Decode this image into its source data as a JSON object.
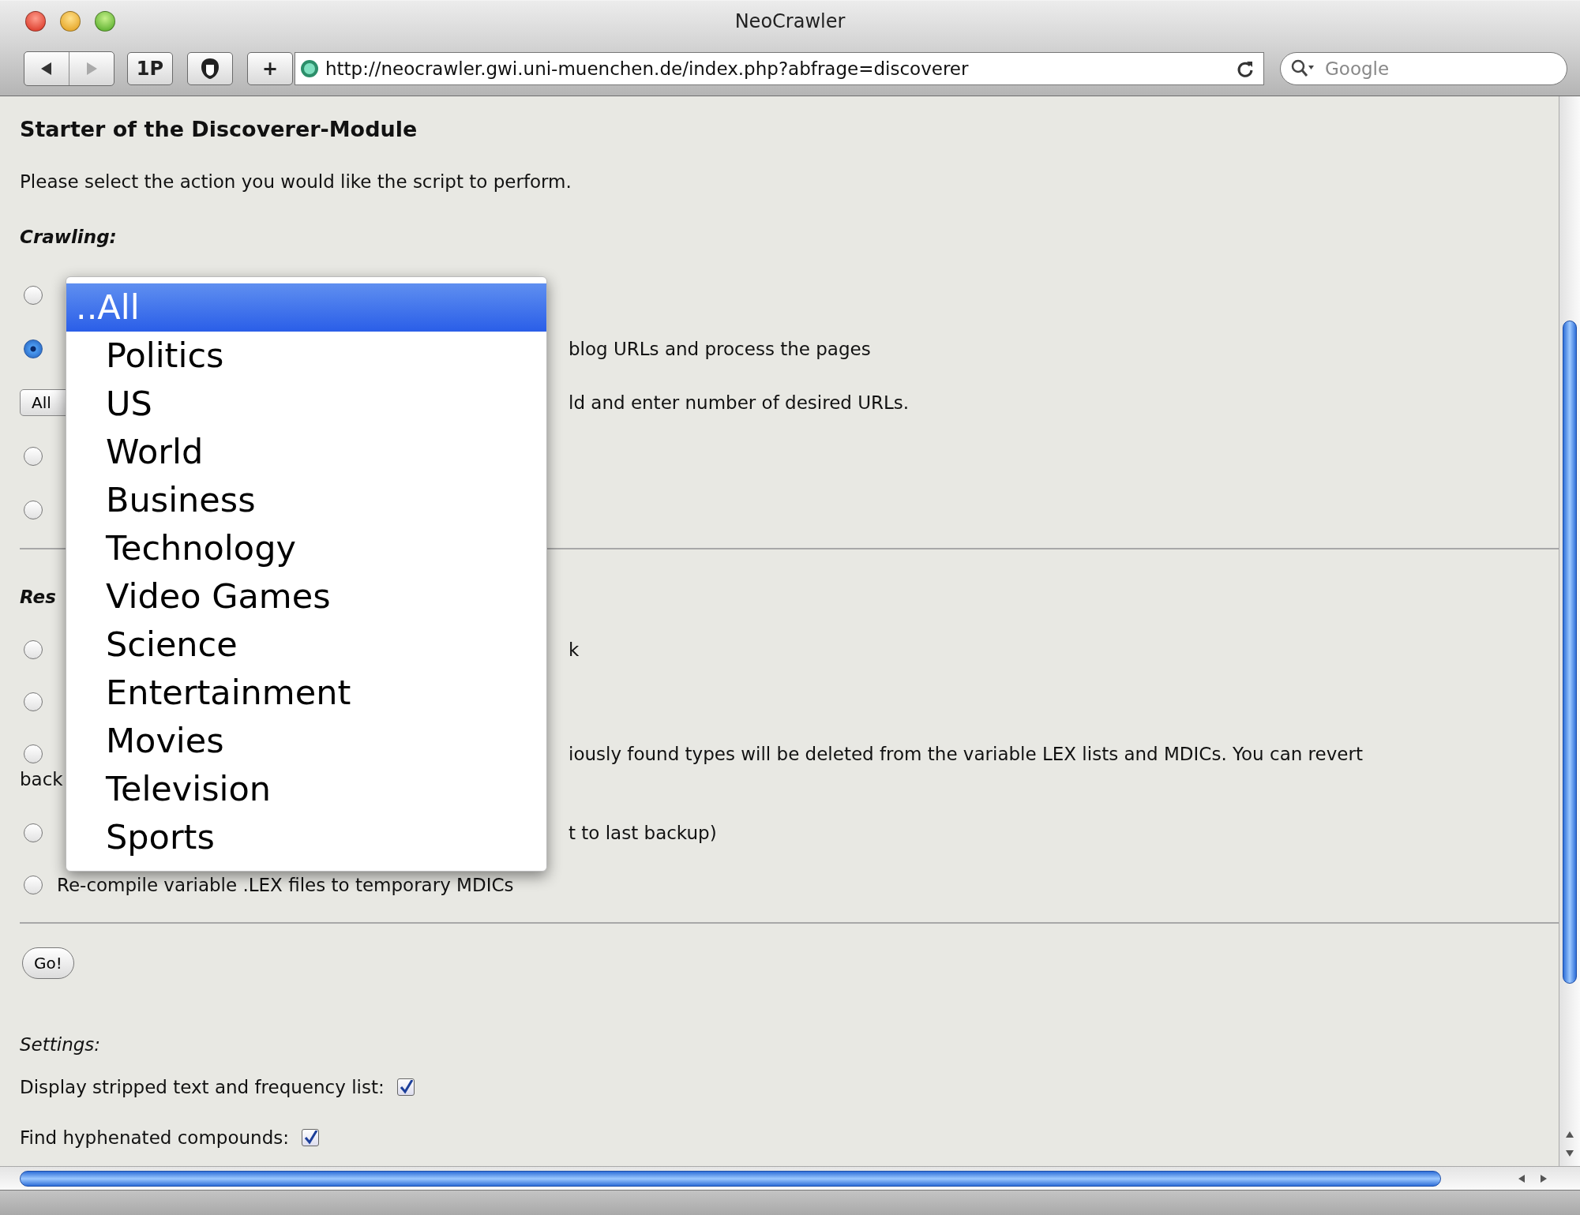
{
  "window": {
    "title": "NeoCrawler"
  },
  "toolbar": {
    "bookmarks_button": "1P",
    "add_button": "+",
    "url": "http://neocrawler.gwi.uni-muenchen.de/index.php?abfrage=discoverer",
    "search": {
      "placeholder": "Google"
    }
  },
  "page": {
    "heading": "Starter of the Discoverer-Module",
    "intro": "Please select the action you would like the script to perform.",
    "sections": [
      {
        "title": "Crawling:",
        "rows": [
          {
            "kind": "radio",
            "selected": false
          },
          {
            "kind": "radio",
            "selected": true,
            "right": "blog URLs and process the pages"
          },
          {
            "kind": "popup",
            "value": "All",
            "right": "ld and enter number of desired URLs."
          },
          {
            "kind": "radio",
            "selected": false
          },
          {
            "kind": "radio",
            "selected": false
          }
        ]
      },
      {
        "title": "Res",
        "rows": [
          {
            "kind": "radio",
            "selected": false,
            "right": "k"
          },
          {
            "kind": "radio",
            "selected": false
          },
          {
            "kind": "radio",
            "selected": false,
            "right": "iously found types will be deleted from the variable LEX lists and MDICs. You can revert",
            "continuation": "back"
          },
          {
            "kind": "radio",
            "selected": false,
            "right": "t to last backup)"
          },
          {
            "kind": "radio",
            "selected": false,
            "left": "Re-compile variable .LEX files to temporary MDICs"
          }
        ]
      }
    ],
    "go_button": "Go!",
    "settings": {
      "title": "Settings:",
      "options": [
        {
          "label": "Display stripped text and frequency list:",
          "checked": true
        },
        {
          "label": "Find hyphenated compounds:",
          "checked": true
        }
      ]
    }
  },
  "dropdown": {
    "items": [
      {
        "label": "..All",
        "selected": true
      },
      {
        "label": "Politics",
        "selected": false
      },
      {
        "label": "US",
        "selected": false
      },
      {
        "label": "World",
        "selected": false
      },
      {
        "label": "Business",
        "selected": false
      },
      {
        "label": "Technology",
        "selected": false
      },
      {
        "label": "Video Games",
        "selected": false
      },
      {
        "label": "Science",
        "selected": false
      },
      {
        "label": "Entertainment",
        "selected": false
      },
      {
        "label": "Movies",
        "selected": false
      },
      {
        "label": "Television",
        "selected": false
      },
      {
        "label": "Sports",
        "selected": false
      }
    ]
  }
}
